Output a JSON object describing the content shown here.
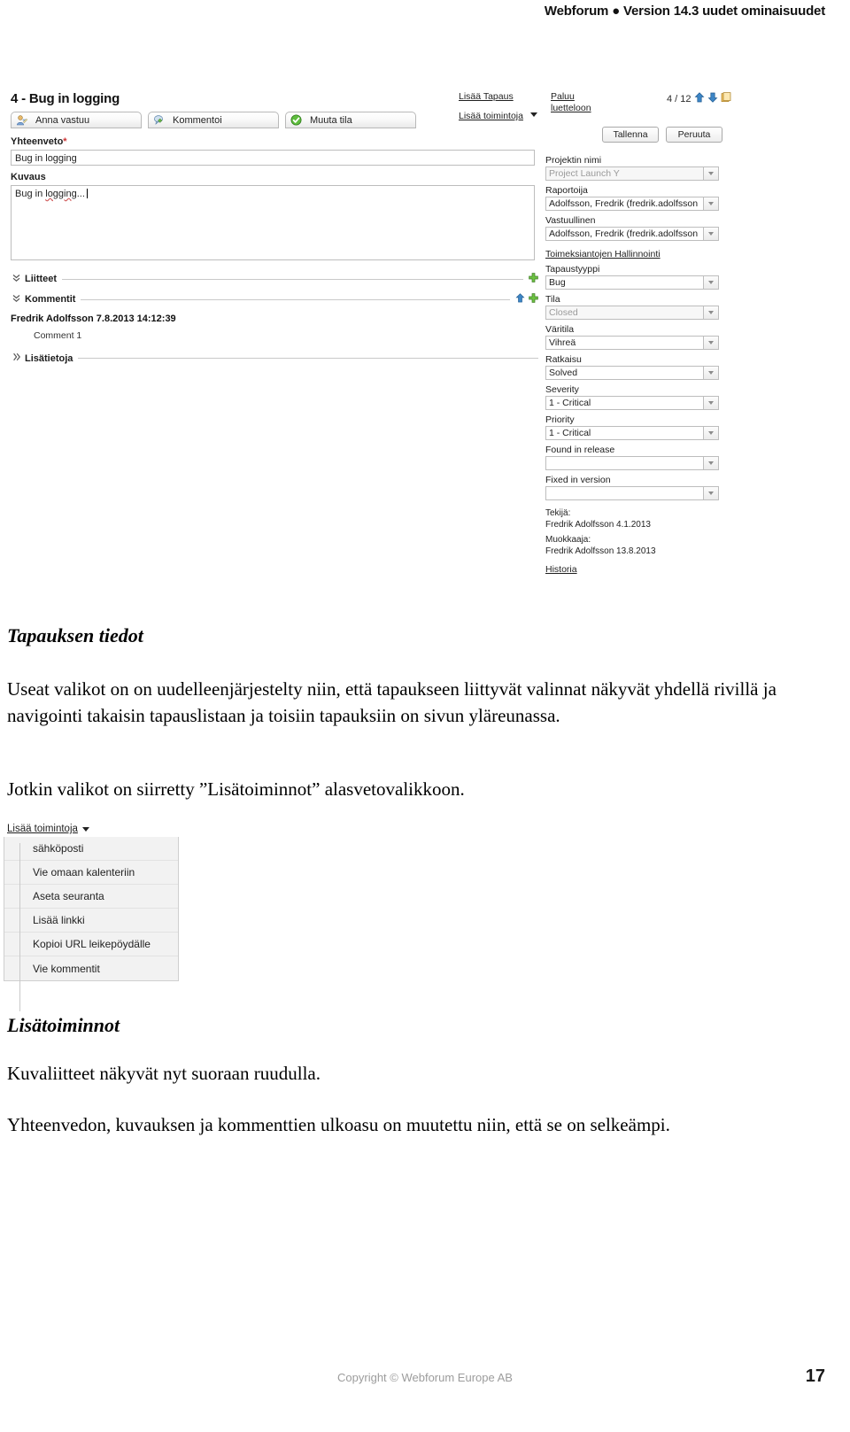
{
  "header": {
    "running_title": "Webforum ● Version 14.3 uudet ominaisuudet"
  },
  "screenshot_case": {
    "title": "4 - Bug in logging",
    "tabs": [
      {
        "label": "Anna vastuu",
        "icon": "assign-user-icon"
      },
      {
        "label": "Kommentoi",
        "icon": "comment-add-icon"
      },
      {
        "label": "Muuta tila",
        "icon": "status-change-icon"
      }
    ],
    "top_links": {
      "add_case": "Lisää Tapaus",
      "more_actions": "Lisää toimintoja",
      "back_to_list_line1": "Paluu",
      "back_to_list_line2": "luetteloon"
    },
    "counter": "4 / 12",
    "buttons": {
      "save": "Tallenna",
      "cancel": "Peruuta"
    },
    "summary": {
      "label": "Yhteenveto",
      "required_mark": "*",
      "value": "Bug in logging"
    },
    "description": {
      "label": "Kuvaus",
      "value_plain": "Bug in ",
      "value_misspelled": "logging",
      "value_tail": "..."
    },
    "sections": {
      "attachments": "Liitteet",
      "comments": "Kommentit",
      "more_info": "Lisätietoja"
    },
    "comment": {
      "author_and_date": "Fredrik Adolfsson 7.8.2013 14:12:39",
      "text": "Comment 1"
    },
    "fields": [
      {
        "label": "Projektin nimi",
        "value": "Project Launch Y",
        "dim": true
      },
      {
        "label": "Raportoija",
        "value": "Adolfsson, Fredrik (fredrik.adolfsson",
        "dim": false
      },
      {
        "label": "Vastuullinen",
        "value": "Adolfsson, Fredrik (fredrik.adolfsson",
        "dim": false
      }
    ],
    "assignment_link": "Toimeksiantojen Hallinnointi",
    "fields2": [
      {
        "label": "Tapaustyyppi",
        "value": "Bug",
        "dim": false
      },
      {
        "label": "Tila",
        "value": "Closed",
        "dim": true
      },
      {
        "label": "Väritila",
        "value": "Vihreä",
        "dim": false
      },
      {
        "label": "Ratkaisu",
        "value": "Solved",
        "dim": false
      },
      {
        "label": "Severity",
        "value": "1 - Critical",
        "dim": false
      },
      {
        "label": "Priority",
        "value": "1 - Critical",
        "dim": false
      },
      {
        "label": "Found in release",
        "value": "",
        "dim": false
      },
      {
        "label": "Fixed in version",
        "value": "",
        "dim": false
      }
    ],
    "meta": {
      "created_label": "Tekijä:",
      "created_value": "Fredrik Adolfsson 4.1.2013",
      "modified_label": "Muokkaaja:",
      "modified_value": "Fredrik Adolfsson 13.8.2013",
      "history_link": "Historia"
    }
  },
  "body": {
    "heading1": "Tapauksen tiedot",
    "para1_line1": "Useat valikot on on uudelleenjärjestelty niin, että tapaukseen liittyvät valinnat",
    "para1_line2": "näkyvät yhdellä rivillä ja navigointi takaisin tapauslistaan ja toisiin tapauksiin on",
    "para1_line3": "sivun yläreunassa.",
    "para2": "Jotkin valikot on siirretty ”Lisätoiminnot” alasvetovalikkoon.",
    "caption1": "Lisätoiminnot",
    "para3": "Kuvaliitteet näkyvät nyt suoraan ruudulla.",
    "para4_line1": "Yhteenvedon, kuvauksen ja kommenttien ulkoasu on muutettu niin, että se on",
    "para4_line2": "selkeämpi."
  },
  "menu_screenshot": {
    "trigger": "Lisää toimintoja",
    "items": [
      "sähköposti",
      "Vie omaan kalenteriin",
      "Aseta seuranta",
      "Lisää linkki",
      "Kopioi URL leikepöydälle",
      "Vie kommentit"
    ]
  },
  "footer": {
    "copyright": "Copyright © Webforum Europe AB",
    "page_number": "17"
  },
  "colors": {
    "accent_blue": "#2f78c4",
    "accent_green": "#5eb53e",
    "required_red": "#cc3333",
    "muted_grey": "#9c9c9c"
  }
}
